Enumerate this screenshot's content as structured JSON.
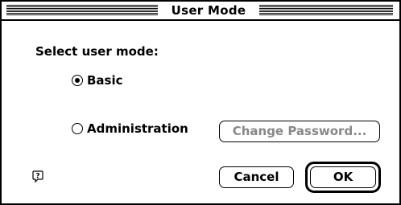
{
  "window": {
    "title": "User Mode"
  },
  "prompt": "Select user mode:",
  "modes": {
    "basic": {
      "label": "Basic",
      "selected": true
    },
    "admin": {
      "label": "Administration",
      "selected": false
    }
  },
  "buttons": {
    "change_password": "Change Password...",
    "cancel": "Cancel",
    "ok": "OK"
  },
  "icons": {
    "help": "help-balloon-icon"
  },
  "colors": {
    "foreground": "#000000",
    "background": "#ffffff",
    "disabled_text": "#888888"
  }
}
